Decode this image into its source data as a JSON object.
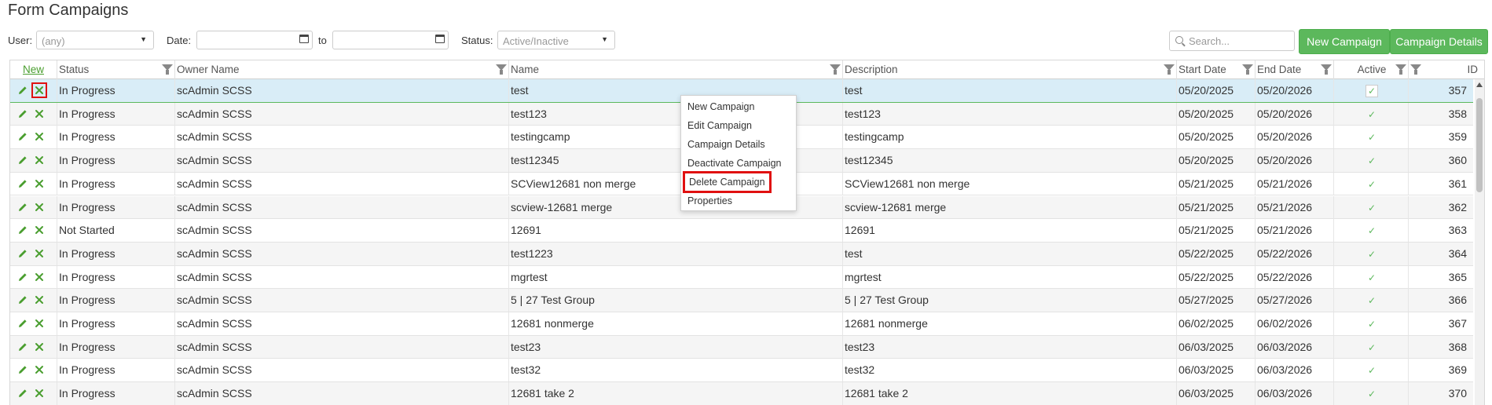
{
  "page": {
    "title": "Form Campaigns"
  },
  "filters": {
    "user_label": "User:",
    "user_value": "(any)",
    "date_label": "Date:",
    "to_label": "to",
    "status_label": "Status:",
    "status_value": "Active/Inactive",
    "search_placeholder": "Search..."
  },
  "toolbar": {
    "new_campaign_label": "New Campaign",
    "campaign_details_label": "Campaign Details",
    "accent_color": "#5cb85c"
  },
  "grid": {
    "columns": {
      "new": "New",
      "status": "Status",
      "owner": "Owner Name",
      "name": "Name",
      "description": "Description",
      "start": "Start Date",
      "end": "End Date",
      "active": "Active",
      "id": "ID"
    },
    "rows": [
      {
        "status": "In Progress",
        "owner": "scAdmin SCSS",
        "name": "test",
        "description": "test",
        "start": "05/20/2025",
        "end": "05/20/2026",
        "active": true,
        "id": "357"
      },
      {
        "status": "In Progress",
        "owner": "scAdmin SCSS",
        "name": "test123",
        "description": "test123",
        "start": "05/20/2025",
        "end": "05/20/2026",
        "active": true,
        "id": "358"
      },
      {
        "status": "In Progress",
        "owner": "scAdmin SCSS",
        "name": "testingcamp",
        "description": "testingcamp",
        "start": "05/20/2025",
        "end": "05/20/2026",
        "active": true,
        "id": "359"
      },
      {
        "status": "In Progress",
        "owner": "scAdmin SCSS",
        "name": "test12345",
        "description": "test12345",
        "start": "05/20/2025",
        "end": "05/20/2026",
        "active": true,
        "id": "360"
      },
      {
        "status": "In Progress",
        "owner": "scAdmin SCSS",
        "name": "SCView12681 non merge",
        "description": "SCView12681 non merge",
        "start": "05/21/2025",
        "end": "05/21/2026",
        "active": true,
        "id": "361"
      },
      {
        "status": "In Progress",
        "owner": "scAdmin SCSS",
        "name": "scview-12681 merge",
        "description": "scview-12681 merge",
        "start": "05/21/2025",
        "end": "05/21/2026",
        "active": true,
        "id": "362"
      },
      {
        "status": "Not Started",
        "owner": "scAdmin SCSS",
        "name": "12691",
        "description": "12691",
        "start": "05/21/2025",
        "end": "05/21/2026",
        "active": true,
        "id": "363"
      },
      {
        "status": "In Progress",
        "owner": "scAdmin SCSS",
        "name": "test1223",
        "description": "test",
        "start": "05/22/2025",
        "end": "05/22/2026",
        "active": true,
        "id": "364"
      },
      {
        "status": "In Progress",
        "owner": "scAdmin SCSS",
        "name": "mgrtest",
        "description": "mgrtest",
        "start": "05/22/2025",
        "end": "05/22/2026",
        "active": true,
        "id": "365"
      },
      {
        "status": "In Progress",
        "owner": "scAdmin SCSS",
        "name": "5 | 27 Test Group",
        "description": "5 | 27 Test Group",
        "start": "05/27/2025",
        "end": "05/27/2026",
        "active": true,
        "id": "366"
      },
      {
        "status": "In Progress",
        "owner": "scAdmin SCSS",
        "name": "12681 nonmerge",
        "description": "12681 nonmerge",
        "start": "06/02/2025",
        "end": "06/02/2026",
        "active": true,
        "id": "367"
      },
      {
        "status": "In Progress",
        "owner": "scAdmin SCSS",
        "name": "test23",
        "description": "test23",
        "start": "06/03/2025",
        "end": "06/03/2026",
        "active": true,
        "id": "368"
      },
      {
        "status": "In Progress",
        "owner": "scAdmin SCSS",
        "name": "test32",
        "description": "test32",
        "start": "06/03/2025",
        "end": "06/03/2026",
        "active": true,
        "id": "369"
      },
      {
        "status": "In Progress",
        "owner": "scAdmin SCSS",
        "name": "12681 take 2",
        "description": "12681 take 2",
        "start": "06/03/2025",
        "end": "06/03/2026",
        "active": true,
        "id": "370"
      }
    ]
  },
  "context_menu": {
    "items": [
      "New Campaign",
      "Edit Campaign",
      "Campaign Details",
      "Deactivate Campaign",
      "Delete Campaign",
      "Properties"
    ],
    "highlighted": "Delete Campaign"
  },
  "icons": {
    "edit": "pencil-icon",
    "delete": "close-icon",
    "active": "checkmark-icon",
    "filter": "filter-funnel-icon",
    "calendar": "calendar-icon",
    "search": "search-icon"
  },
  "colors": {
    "highlight_outline": "#e01010",
    "selected_row": "#d9edf7",
    "check": "#5cb85c"
  }
}
